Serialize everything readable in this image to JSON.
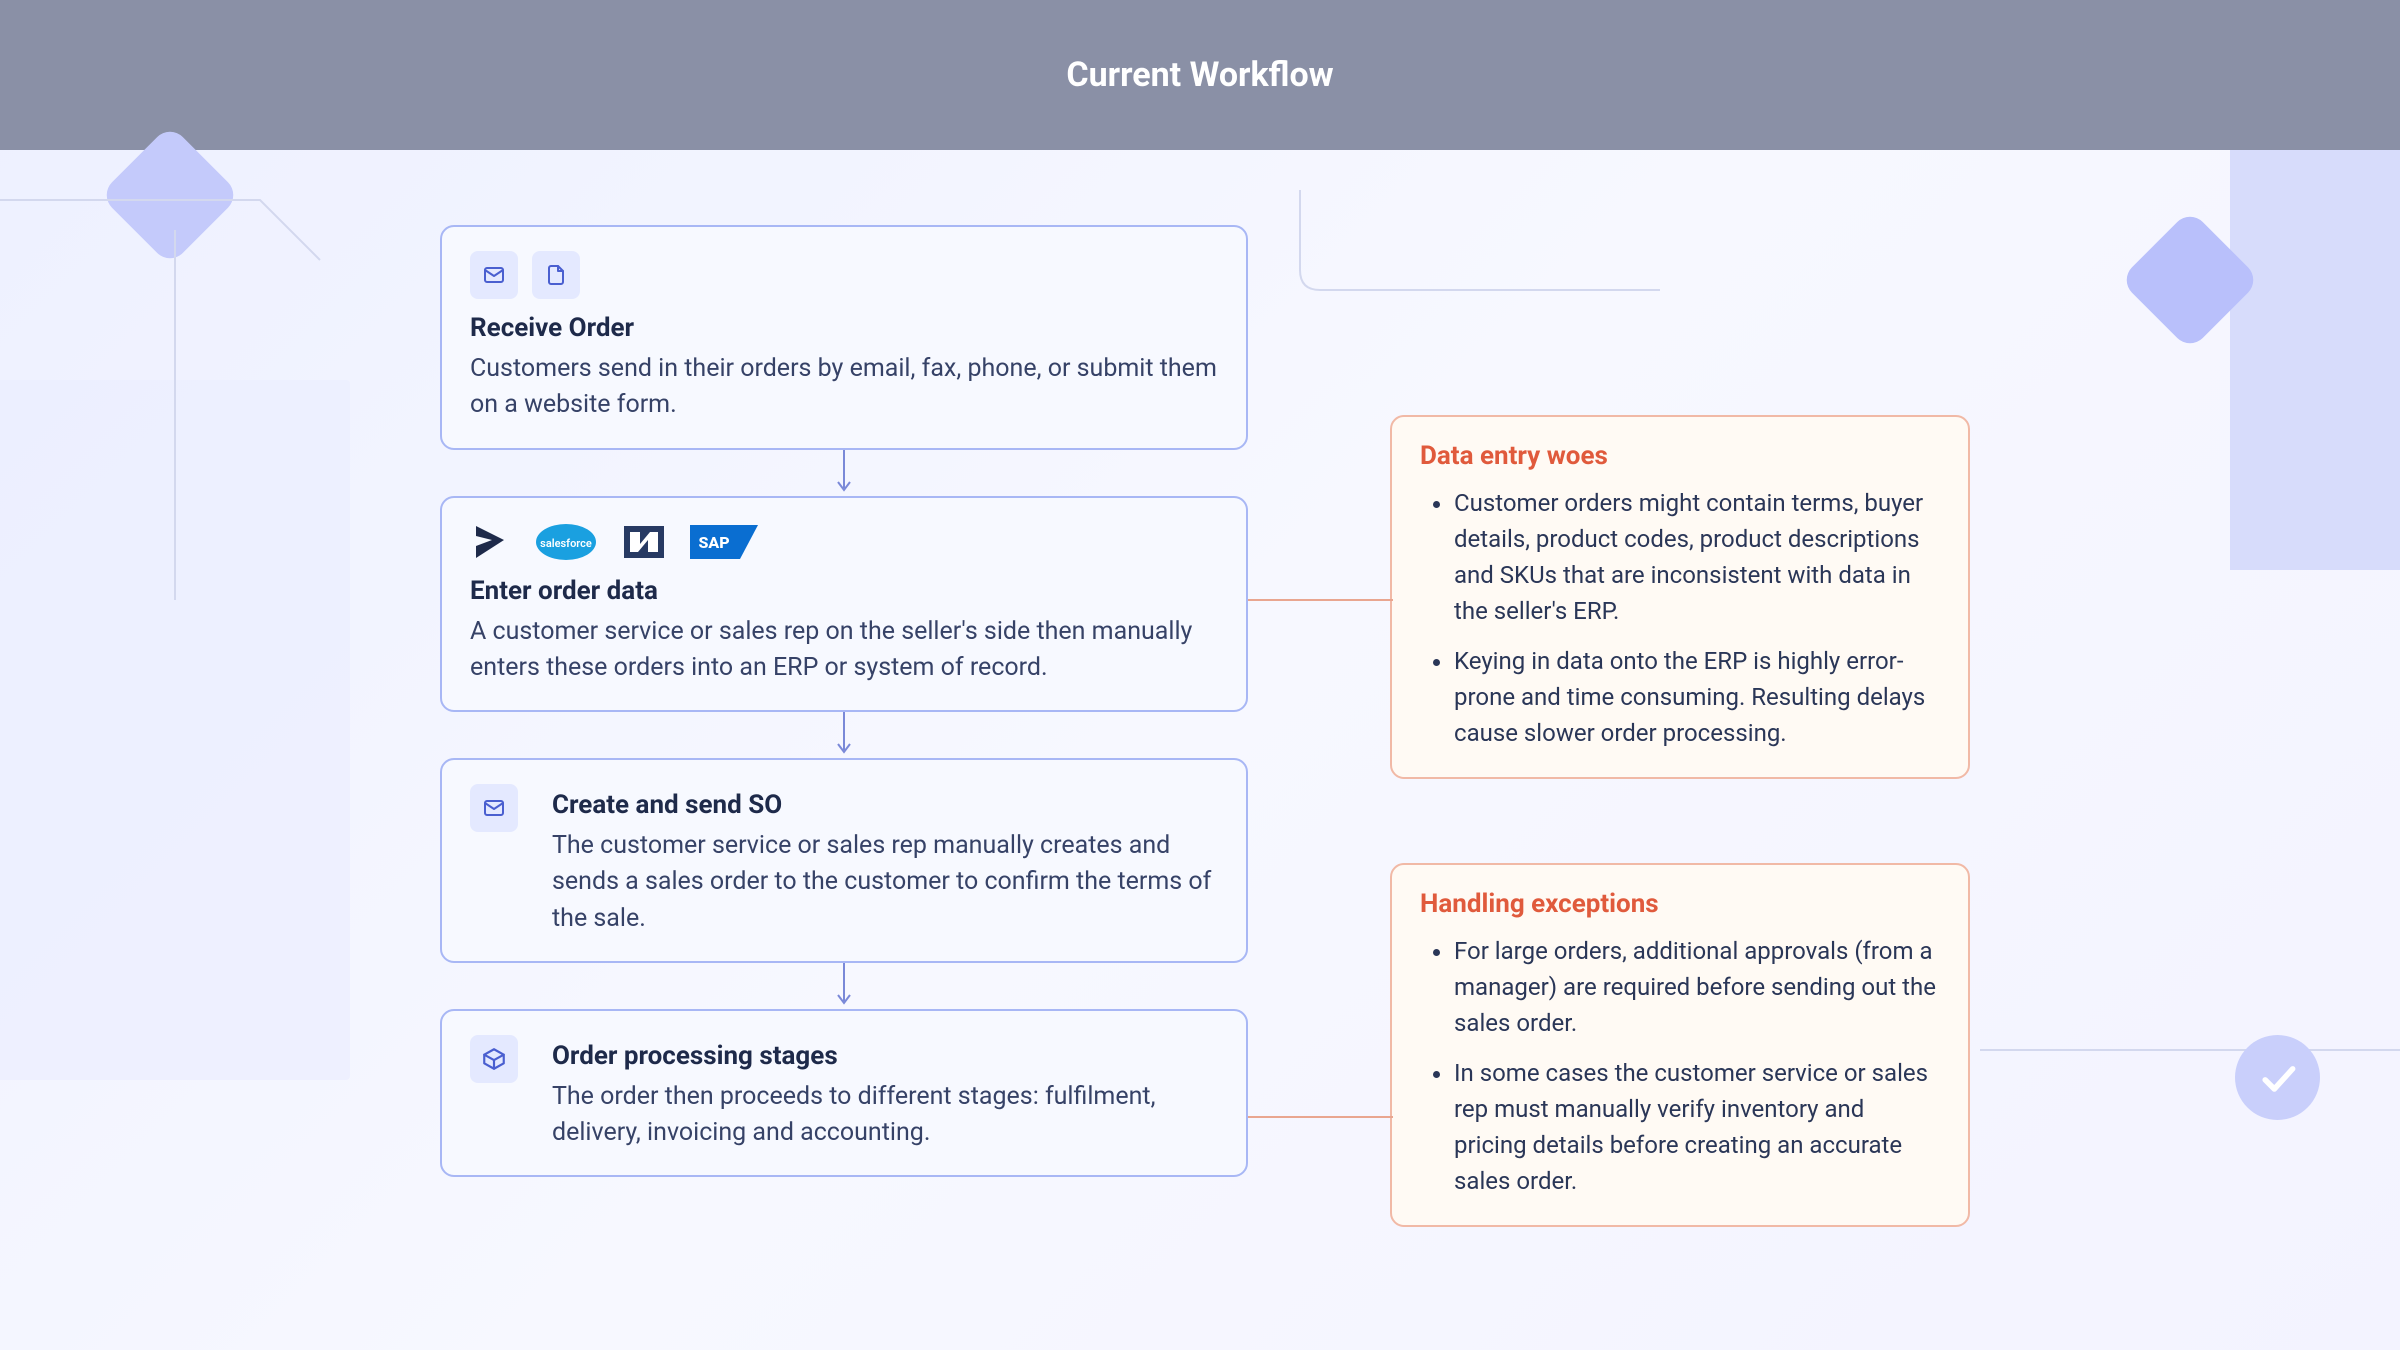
{
  "header": {
    "title": "Current Workflow"
  },
  "workflow": [
    {
      "id": "receive-order",
      "title": "Receive Order",
      "desc": "Customers send in their orders by email, fax, phone, or submit them on a website form.",
      "icons": [
        "mail-icon",
        "document-icon"
      ]
    },
    {
      "id": "enter-order-data",
      "title": "Enter order data",
      "desc": "A customer service or sales rep on the seller's side then manually enters these orders into an ERP or system of record.",
      "logos": [
        "dynamics",
        "salesforce",
        "netsuite",
        "sap"
      ]
    },
    {
      "id": "create-send-so",
      "title": "Create and send SO",
      "desc": "The customer service or sales rep manually creates and sends a sales order to the customer to confirm the terms of the sale.",
      "icons": [
        "mail-icon"
      ]
    },
    {
      "id": "order-processing",
      "title": "Order processing stages",
      "desc": "The order then proceeds to different stages: fulfilment, delivery, invoicing and accounting.",
      "icons": [
        "box-icon"
      ]
    }
  ],
  "callouts": [
    {
      "id": "data-entry-woes",
      "title": "Data entry woes",
      "bullets": [
        "Customer orders might contain terms, buyer details, product codes, product descriptions and SKUs that are inconsistent with data in the seller's ERP.",
        "Keying in data onto the ERP is highly error-prone and time consuming. Resulting delays cause slower order processing."
      ]
    },
    {
      "id": "handling-exceptions",
      "title": "Handling exceptions",
      "bullets": [
        "For large orders, additional approvals (from a manager) are required before sending out the sales order.",
        "In some cases the customer service or sales rep must manually verify inventory and pricing details before creating an accurate sales order."
      ]
    }
  ],
  "colors": {
    "card_border": "#a8b7f5",
    "callout_border": "#f1b9a6",
    "callout_title": "#e05a3c"
  }
}
